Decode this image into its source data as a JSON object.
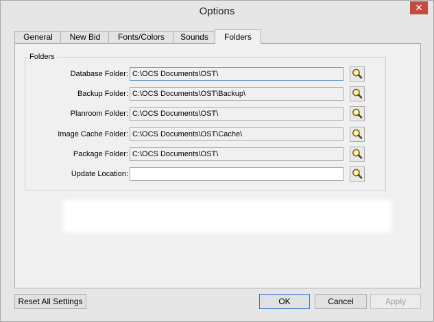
{
  "window": {
    "title": "Options",
    "close_symbol": "✕"
  },
  "tabs": [
    {
      "label": "General"
    },
    {
      "label": "New Bid"
    },
    {
      "label": "Fonts/Colors"
    },
    {
      "label": "Sounds"
    },
    {
      "label": "Folders",
      "active": true
    }
  ],
  "folders_group": {
    "label": "Folders",
    "rows": [
      {
        "label": "Database Folder:",
        "value": "C:\\OCS Documents\\OST\\",
        "icon": "magnifier-icon"
      },
      {
        "label": "Backup Folder:",
        "value": "C:\\OCS Documents\\OST\\Backup\\",
        "icon": "magnifier-icon"
      },
      {
        "label": "Planroom Folder:",
        "value": "C:\\OCS Documents\\OST\\",
        "icon": "magnifier-icon"
      },
      {
        "label": "Image Cache Folder:",
        "value": "C:\\OCS Documents\\OST\\Cache\\",
        "icon": "magnifier-icon"
      },
      {
        "label": "Package Folder:",
        "value": "C:\\OCS Documents\\OST\\",
        "icon": "magnifier-icon"
      },
      {
        "label": "Update Location:",
        "value": "",
        "icon": "magnifier-icon"
      }
    ]
  },
  "buttons": {
    "reset": "Reset All Settings",
    "ok": "OK",
    "cancel": "Cancel",
    "apply": "Apply"
  },
  "colors": {
    "close_button": "#c74a3f",
    "default_button_border": "#3b7bd3"
  }
}
